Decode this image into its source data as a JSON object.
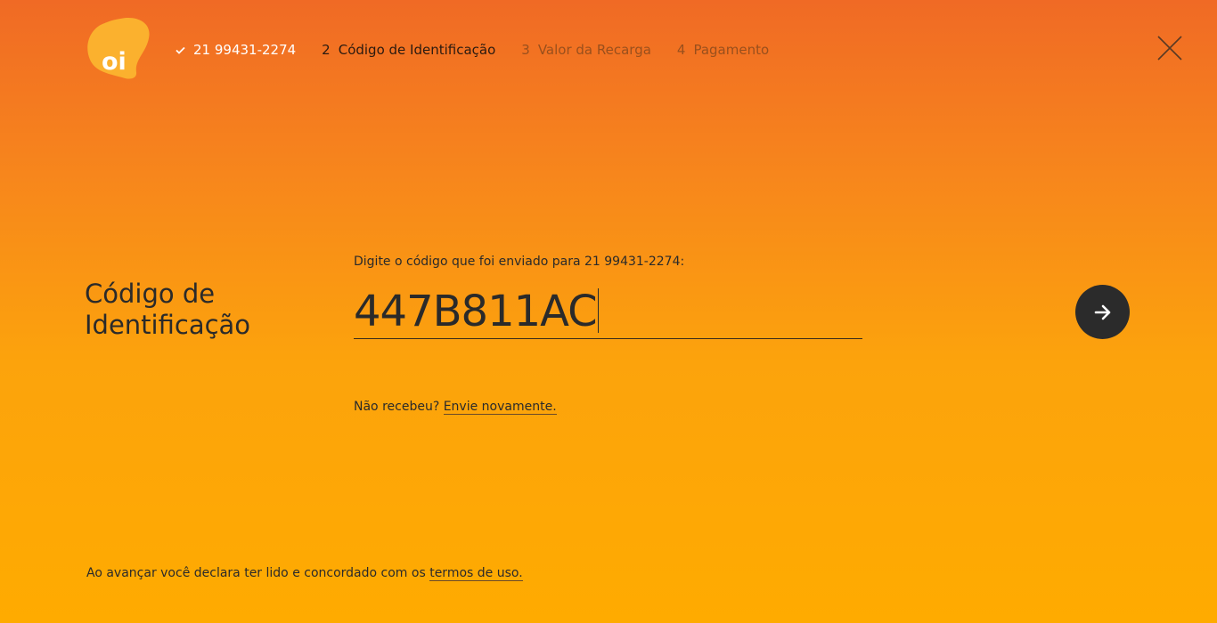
{
  "brand": {
    "logo_text": "oi",
    "logo_color": "#fbb12e"
  },
  "steps": [
    {
      "status": "done",
      "num": "",
      "label": "21 99431-2274",
      "icon": "check-icon"
    },
    {
      "status": "active",
      "num": "2",
      "label": "Código de Identificação"
    },
    {
      "status": "pending",
      "num": "3",
      "label": "Valor da Recarga"
    },
    {
      "status": "pending",
      "num": "4",
      "label": "Pagamento"
    }
  ],
  "close": {
    "icon": "close-icon"
  },
  "main": {
    "title": "Código de Identificação",
    "prompt": "Digite o código que foi enviado para 21 99431-2274:",
    "code_value": "447B811AC",
    "next": {
      "icon": "arrow-right-icon"
    },
    "resend_prefix": "Não recebeu?",
    "resend_link": "Envie novamente."
  },
  "footer": {
    "terms_prefix": "Ao avançar você declara ter lido e concordado com os",
    "terms_link": "termos de uso."
  },
  "colors": {
    "gradient_top": "#f06a25",
    "gradient_bottom": "#ffab00",
    "button_dark": "#2b2b2b"
  }
}
